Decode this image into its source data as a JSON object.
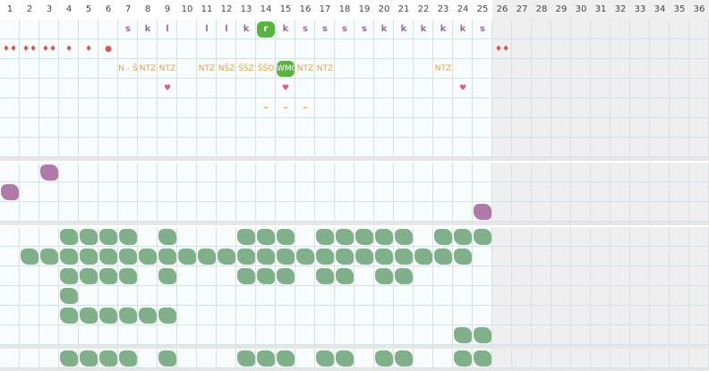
{
  "columns": [
    "1",
    "2",
    "3",
    "4",
    "5",
    "6",
    "7",
    "8",
    "9",
    "10",
    "11",
    "12",
    "13",
    "14",
    "15",
    "16",
    "17",
    "18",
    "19",
    "20",
    "21",
    "22",
    "23",
    "24",
    "25",
    "26",
    "27",
    "28",
    "29",
    "30",
    "31",
    "32",
    "33",
    "34",
    "35",
    "36"
  ],
  "active_columns": 25,
  "colors": {
    "grid_line": "#cfe4ea",
    "inactive_bg": "#efefef",
    "separator": "#e6e6e6",
    "purple_text": "#9a6b9e",
    "orange_text": "#e8a23a",
    "drop_red": "#d9534f",
    "heart_pink": "#e05c7a",
    "green_blob": "#7fb08a",
    "green_highlight": "#58b33f",
    "purple_blob": "#b07aa8"
  },
  "letters_row": [
    {
      "col": 7,
      "text": "s"
    },
    {
      "col": 8,
      "text": "k"
    },
    {
      "col": 9,
      "text": "l"
    },
    {
      "col": 11,
      "text": "l"
    },
    {
      "col": 12,
      "text": "l"
    },
    {
      "col": 13,
      "text": "k"
    },
    {
      "col": 14,
      "text": "r",
      "highlight": true
    },
    {
      "col": 15,
      "text": "k"
    },
    {
      "col": 16,
      "text": "s"
    },
    {
      "col": 17,
      "text": "s"
    },
    {
      "col": 18,
      "text": "s"
    },
    {
      "col": 19,
      "text": "s"
    },
    {
      "col": 20,
      "text": "k"
    },
    {
      "col": 21,
      "text": "k"
    },
    {
      "col": 22,
      "text": "k"
    },
    {
      "col": 23,
      "text": "k"
    },
    {
      "col": 24,
      "text": "k"
    },
    {
      "col": 25,
      "text": "s"
    }
  ],
  "drops_row": [
    {
      "col": 1,
      "text": "♦♦"
    },
    {
      "col": 2,
      "text": "♦♦"
    },
    {
      "col": 3,
      "text": "♦♦"
    },
    {
      "col": 4,
      "text": "♦"
    },
    {
      "col": 5,
      "text": "♦"
    },
    {
      "col": 6,
      "text": "●"
    },
    {
      "col": 26,
      "text": "♦♦"
    }
  ],
  "codes_row": [
    {
      "col": 7,
      "text": "N - Š"
    },
    {
      "col": 8,
      "text": "NTZ"
    },
    {
      "col": 9,
      "text": "NTZ"
    },
    {
      "col": 11,
      "text": "NTZ"
    },
    {
      "col": 12,
      "text": "NŠZ"
    },
    {
      "col": 13,
      "text": "ŠŠZ"
    },
    {
      "col": 14,
      "text": "ŠŠO"
    },
    {
      "col": 15,
      "text": "WMO",
      "highlight": true
    },
    {
      "col": 16,
      "text": "NTZ"
    },
    {
      "col": 17,
      "text": "NTZ"
    },
    {
      "col": 23,
      "text": "NTZ"
    }
  ],
  "hearts_row": [
    {
      "col": 9,
      "text": "♥"
    },
    {
      "col": 15,
      "text": "♥"
    },
    {
      "col": 24,
      "text": "♥"
    }
  ],
  "dashes_row": [
    {
      "col": 14,
      "text": "–"
    },
    {
      "col": 15,
      "text": "–"
    },
    {
      "col": 16,
      "text": "–"
    }
  ],
  "section2_purple": [
    {
      "row": 0,
      "col": 3
    },
    {
      "row": 1,
      "col": 1
    },
    {
      "row": 2,
      "col": 25
    }
  ],
  "section3_green": [
    [
      4,
      5,
      6,
      7,
      9,
      13,
      14,
      15,
      17,
      18,
      19,
      20,
      21,
      23,
      24,
      25
    ],
    [
      2,
      3,
      4,
      5,
      6,
      7,
      8,
      9,
      10,
      11,
      12,
      13,
      14,
      15,
      16,
      17,
      18,
      19,
      20,
      21,
      22,
      23,
      24
    ],
    [
      4,
      5,
      6,
      7,
      9,
      13,
      14,
      15,
      17,
      18,
      20,
      21
    ],
    [
      4
    ],
    [
      4,
      5,
      6,
      7,
      8,
      9
    ],
    [
      24,
      25
    ]
  ],
  "section4_green": [
    4,
    5,
    6,
    7,
    9,
    13,
    14,
    15,
    17,
    18,
    20,
    21,
    24,
    25
  ]
}
